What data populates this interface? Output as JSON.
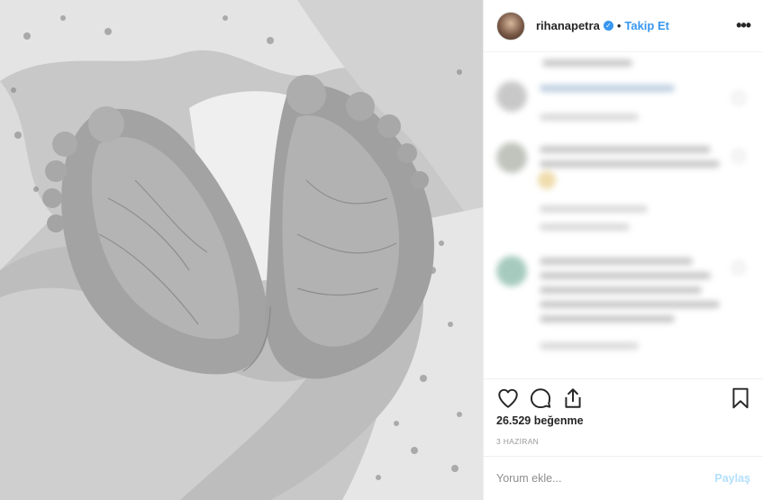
{
  "header": {
    "username": "rihanapetra",
    "separator": "•",
    "follow_label": "Takip Et",
    "more_label": "•••"
  },
  "photo": {
    "alt_description_icon": "baby-feet-photo"
  },
  "actions": {
    "like_icon": "heart-icon",
    "comment_icon": "comment-icon",
    "share_icon": "share-icon",
    "save_icon": "bookmark-icon"
  },
  "likes_text": "26.529 beğenme",
  "date_text": "3 HAZİRAN",
  "comment": {
    "placeholder": "Yorum ekle...",
    "post_label": "Paylaş"
  },
  "colors": {
    "accent": "#3897f0",
    "post_disabled": "#b2dffc",
    "text": "#262626",
    "muted": "#8e8e8e"
  }
}
